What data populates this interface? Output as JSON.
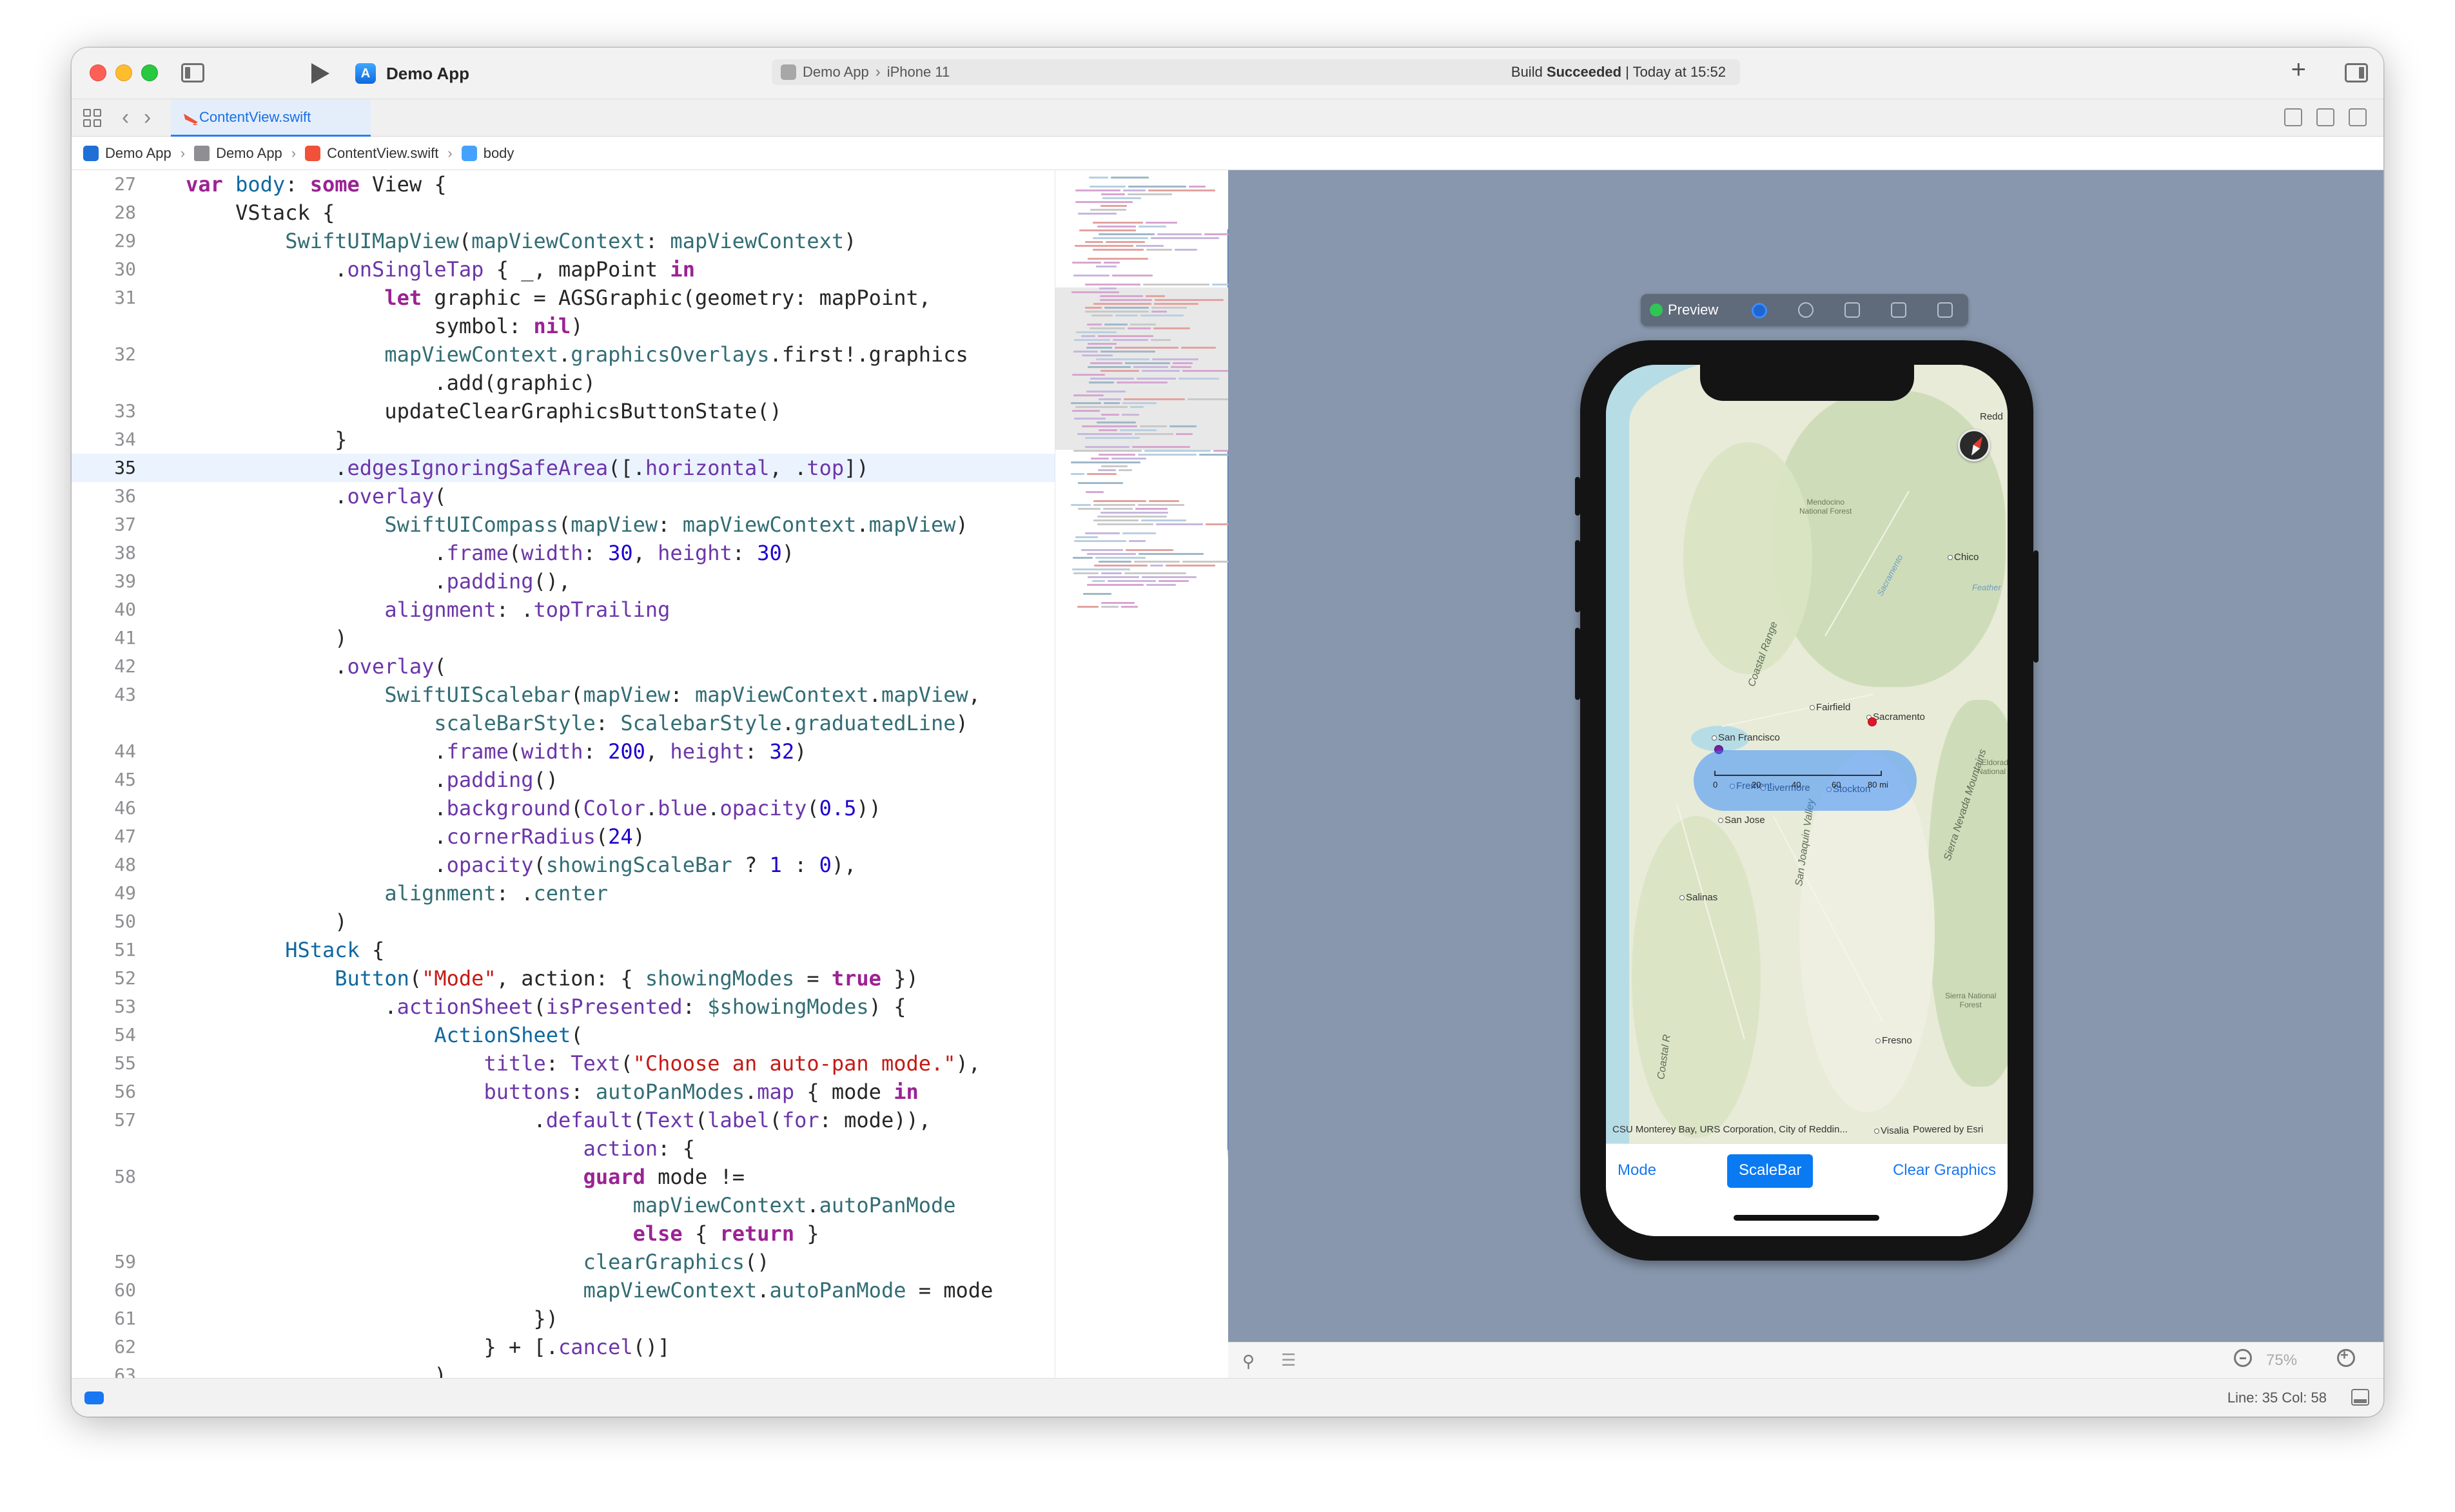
{
  "toolbar": {
    "app_title": "Demo App",
    "scheme_app": "Demo App",
    "scheme_device": "iPhone 11",
    "build_status_prefix": "Build",
    "build_status_bold": "Succeeded",
    "build_status_time": "| Today at 15:52"
  },
  "tabs": [
    {
      "label": "ContentView.swift",
      "active": true
    }
  ],
  "jumpbar": {
    "items": [
      "Demo App",
      "Demo App",
      "ContentView.swift",
      "body"
    ]
  },
  "editor": {
    "highlighted_line": 35,
    "lines": [
      {
        "num": "27",
        "tokens": [
          {
            "t": "    "
          },
          {
            "t": "var",
            "c": "kw"
          },
          {
            "t": " "
          },
          {
            "t": "body",
            "c": "ty"
          },
          {
            "t": ": "
          },
          {
            "t": "some",
            "c": "kw"
          },
          {
            "t": " View {"
          }
        ]
      },
      {
        "num": "28",
        "tokens": [
          {
            "t": "        VStack {"
          }
        ]
      },
      {
        "num": "29",
        "tokens": [
          {
            "t": "            "
          },
          {
            "t": "SwiftUIMapView",
            "c": "fn"
          },
          {
            "t": "("
          },
          {
            "t": "mapViewContext",
            "c": "fn"
          },
          {
            "t": ": "
          },
          {
            "t": "mapViewContext",
            "c": "fn"
          },
          {
            "t": ")"
          }
        ]
      },
      {
        "num": "30",
        "tokens": [
          {
            "t": "                ."
          },
          {
            "t": "onSingleTap",
            "c": "mt"
          },
          {
            "t": " { _, mapPoint "
          },
          {
            "t": "in",
            "c": "kw"
          }
        ]
      },
      {
        "num": "31",
        "tokens": [
          {
            "t": "                    "
          },
          {
            "t": "let",
            "c": "kw"
          },
          {
            "t": " graphic = AGSGraphic(geometry: mapPoint,"
          }
        ]
      },
      {
        "num": "",
        "tokens": [
          {
            "t": "                        symbol: "
          },
          {
            "t": "nil",
            "c": "kw"
          },
          {
            "t": ")"
          }
        ]
      },
      {
        "num": "32",
        "tokens": [
          {
            "t": "                    "
          },
          {
            "t": "mapViewContext",
            "c": "fn"
          },
          {
            "t": "."
          },
          {
            "t": "graphicsOverlays",
            "c": "fn"
          },
          {
            "t": ".first!.graphics"
          }
        ]
      },
      {
        "num": "",
        "tokens": [
          {
            "t": "                        .add(graphic)"
          }
        ]
      },
      {
        "num": "33",
        "tokens": [
          {
            "t": "                    updateClearGraphicsButtonState()"
          }
        ]
      },
      {
        "num": "34",
        "tokens": [
          {
            "t": "                }"
          }
        ]
      },
      {
        "num": "35",
        "tokens": [
          {
            "t": "                ."
          },
          {
            "t": "edgesIgnoringSafeArea",
            "c": "mt"
          },
          {
            "t": "([."
          },
          {
            "t": "horizontal",
            "c": "mt"
          },
          {
            "t": ", ."
          },
          {
            "t": "top",
            "c": "mt"
          },
          {
            "t": "])"
          }
        ]
      },
      {
        "num": "36",
        "tokens": [
          {
            "t": "                ."
          },
          {
            "t": "overlay",
            "c": "mt"
          },
          {
            "t": "("
          }
        ]
      },
      {
        "num": "37",
        "tokens": [
          {
            "t": "                    "
          },
          {
            "t": "SwiftUICompass",
            "c": "fn"
          },
          {
            "t": "("
          },
          {
            "t": "mapView",
            "c": "fn"
          },
          {
            "t": ": "
          },
          {
            "t": "mapViewContext",
            "c": "fn"
          },
          {
            "t": "."
          },
          {
            "t": "mapView",
            "c": "fn"
          },
          {
            "t": ")"
          }
        ]
      },
      {
        "num": "38",
        "tokens": [
          {
            "t": "                        ."
          },
          {
            "t": "frame",
            "c": "mt"
          },
          {
            "t": "("
          },
          {
            "t": "width",
            "c": "mt"
          },
          {
            "t": ": "
          },
          {
            "t": "30",
            "c": "nm"
          },
          {
            "t": ", "
          },
          {
            "t": "height",
            "c": "mt"
          },
          {
            "t": ": "
          },
          {
            "t": "30",
            "c": "nm"
          },
          {
            "t": ")"
          }
        ]
      },
      {
        "num": "39",
        "tokens": [
          {
            "t": "                        ."
          },
          {
            "t": "padding",
            "c": "mt"
          },
          {
            "t": "(),"
          }
        ]
      },
      {
        "num": "40",
        "tokens": [
          {
            "t": "                    "
          },
          {
            "t": "alignment",
            "c": "mt"
          },
          {
            "t": ": ."
          },
          {
            "t": "topTrailing",
            "c": "mt"
          }
        ]
      },
      {
        "num": "41",
        "tokens": [
          {
            "t": "                )"
          }
        ]
      },
      {
        "num": "42",
        "tokens": [
          {
            "t": "                ."
          },
          {
            "t": "overlay",
            "c": "mt"
          },
          {
            "t": "("
          }
        ]
      },
      {
        "num": "43",
        "tokens": [
          {
            "t": "                    "
          },
          {
            "t": "SwiftUIScalebar",
            "c": "fn"
          },
          {
            "t": "("
          },
          {
            "t": "mapView",
            "c": "fn"
          },
          {
            "t": ": "
          },
          {
            "t": "mapViewContext",
            "c": "fn"
          },
          {
            "t": "."
          },
          {
            "t": "mapView",
            "c": "fn"
          },
          {
            "t": ","
          }
        ]
      },
      {
        "num": "",
        "tokens": [
          {
            "t": "                        "
          },
          {
            "t": "scaleBarStyle",
            "c": "fn"
          },
          {
            "t": ": "
          },
          {
            "t": "ScalebarStyle",
            "c": "fn"
          },
          {
            "t": "."
          },
          {
            "t": "graduatedLine",
            "c": "fn"
          },
          {
            "t": ")"
          }
        ]
      },
      {
        "num": "44",
        "tokens": [
          {
            "t": "                        ."
          },
          {
            "t": "frame",
            "c": "mt"
          },
          {
            "t": "("
          },
          {
            "t": "width",
            "c": "mt"
          },
          {
            "t": ": "
          },
          {
            "t": "200",
            "c": "nm"
          },
          {
            "t": ", "
          },
          {
            "t": "height",
            "c": "mt"
          },
          {
            "t": ": "
          },
          {
            "t": "32",
            "c": "nm"
          },
          {
            "t": ")"
          }
        ]
      },
      {
        "num": "45",
        "tokens": [
          {
            "t": "                        ."
          },
          {
            "t": "padding",
            "c": "mt"
          },
          {
            "t": "()"
          }
        ]
      },
      {
        "num": "46",
        "tokens": [
          {
            "t": "                        ."
          },
          {
            "t": "background",
            "c": "mt"
          },
          {
            "t": "("
          },
          {
            "t": "Color",
            "c": "mt"
          },
          {
            "t": "."
          },
          {
            "t": "blue",
            "c": "mt"
          },
          {
            "t": "."
          },
          {
            "t": "opacity",
            "c": "mt"
          },
          {
            "t": "("
          },
          {
            "t": "0.5",
            "c": "nm"
          },
          {
            "t": "))"
          }
        ]
      },
      {
        "num": "47",
        "tokens": [
          {
            "t": "                        ."
          },
          {
            "t": "cornerRadius",
            "c": "mt"
          },
          {
            "t": "("
          },
          {
            "t": "24",
            "c": "nm"
          },
          {
            "t": ")"
          }
        ]
      },
      {
        "num": "48",
        "tokens": [
          {
            "t": "                        ."
          },
          {
            "t": "opacity",
            "c": "mt"
          },
          {
            "t": "("
          },
          {
            "t": "showingScaleBar",
            "c": "fn"
          },
          {
            "t": " ? "
          },
          {
            "t": "1",
            "c": "nm"
          },
          {
            "t": " : "
          },
          {
            "t": "0",
            "c": "nm"
          },
          {
            "t": "),"
          }
        ]
      },
      {
        "num": "49",
        "tokens": [
          {
            "t": "                    "
          },
          {
            "t": "alignment",
            "c": "fn"
          },
          {
            "t": ": ."
          },
          {
            "t": "center",
            "c": "fn"
          }
        ]
      },
      {
        "num": "50",
        "tokens": [
          {
            "t": "                )"
          }
        ]
      },
      {
        "num": "51",
        "tokens": [
          {
            "t": "            "
          },
          {
            "t": "HStack",
            "c": "ty"
          },
          {
            "t": " {"
          }
        ]
      },
      {
        "num": "52",
        "tokens": [
          {
            "t": "                "
          },
          {
            "t": "Button",
            "c": "ty"
          },
          {
            "t": "("
          },
          {
            "t": "\"Mode\"",
            "c": "st"
          },
          {
            "t": ", action: { "
          },
          {
            "t": "showingModes",
            "c": "fn"
          },
          {
            "t": " = "
          },
          {
            "t": "true",
            "c": "kw"
          },
          {
            "t": " })"
          }
        ]
      },
      {
        "num": "53",
        "tokens": [
          {
            "t": "                    ."
          },
          {
            "t": "actionSheet",
            "c": "mt"
          },
          {
            "t": "("
          },
          {
            "t": "isPresented",
            "c": "mt"
          },
          {
            "t": ": "
          },
          {
            "t": "$showingModes",
            "c": "fn"
          },
          {
            "t": ") {"
          }
        ]
      },
      {
        "num": "54",
        "tokens": [
          {
            "t": "                        "
          },
          {
            "t": "ActionSheet",
            "c": "ty"
          },
          {
            "t": "("
          }
        ]
      },
      {
        "num": "55",
        "tokens": [
          {
            "t": "                            "
          },
          {
            "t": "title",
            "c": "mt"
          },
          {
            "t": ": "
          },
          {
            "t": "Text",
            "c": "mt"
          },
          {
            "t": "("
          },
          {
            "t": "\"Choose an auto-pan mode.\"",
            "c": "st"
          },
          {
            "t": "),"
          }
        ]
      },
      {
        "num": "56",
        "tokens": [
          {
            "t": "                            "
          },
          {
            "t": "buttons",
            "c": "mt"
          },
          {
            "t": ": "
          },
          {
            "t": "autoPanModes",
            "c": "fn"
          },
          {
            "t": "."
          },
          {
            "t": "map",
            "c": "mt"
          },
          {
            "t": " { mode "
          },
          {
            "t": "in",
            "c": "kw"
          }
        ]
      },
      {
        "num": "57",
        "tokens": [
          {
            "t": "                                ."
          },
          {
            "t": "default",
            "c": "mt"
          },
          {
            "t": "("
          },
          {
            "t": "Text",
            "c": "mt"
          },
          {
            "t": "("
          },
          {
            "t": "label",
            "c": "mt"
          },
          {
            "t": "("
          },
          {
            "t": "for",
            "c": "mt"
          },
          {
            "t": ": mode)),"
          }
        ]
      },
      {
        "num": "",
        "tokens": [
          {
            "t": "                                    "
          },
          {
            "t": "action",
            "c": "mt"
          },
          {
            "t": ": {"
          }
        ]
      },
      {
        "num": "58",
        "tokens": [
          {
            "t": "                                    "
          },
          {
            "t": "guard",
            "c": "kw"
          },
          {
            "t": " mode !="
          }
        ]
      },
      {
        "num": "",
        "tokens": [
          {
            "t": "                                        "
          },
          {
            "t": "mapViewContext",
            "c": "fn"
          },
          {
            "t": "."
          },
          {
            "t": "autoPanMode",
            "c": "fn"
          }
        ]
      },
      {
        "num": "",
        "tokens": [
          {
            "t": "                                        "
          },
          {
            "t": "else",
            "c": "kw"
          },
          {
            "t": " { "
          },
          {
            "t": "return",
            "c": "kw"
          },
          {
            "t": " }"
          }
        ]
      },
      {
        "num": "59",
        "tokens": [
          {
            "t": "                                    "
          },
          {
            "t": "clearGraphics",
            "c": "fn"
          },
          {
            "t": "()"
          }
        ]
      },
      {
        "num": "60",
        "tokens": [
          {
            "t": "                                    "
          },
          {
            "t": "mapViewContext",
            "c": "fn"
          },
          {
            "t": "."
          },
          {
            "t": "autoPanMode",
            "c": "fn"
          },
          {
            "t": " = mode"
          }
        ]
      },
      {
        "num": "61",
        "tokens": [
          {
            "t": "                                })"
          }
        ]
      },
      {
        "num": "62",
        "tokens": [
          {
            "t": "                            } + [."
          },
          {
            "t": "cancel",
            "c": "mt"
          },
          {
            "t": "()]"
          }
        ]
      },
      {
        "num": "63",
        "tokens": [
          {
            "t": "                        )"
          }
        ]
      }
    ]
  },
  "preview": {
    "label": "Preview",
    "map": {
      "cities": [
        "Redd",
        "Chico",
        "Fairfield",
        "Sacramento",
        "San Francisco",
        "Fremont",
        "Livermore",
        "Stockton",
        "San Jose",
        "Salinas",
        "Fresno",
        "Visalia"
      ],
      "regions": [
        "Mendocino\nNational Forest",
        "Eldorad\nNational F",
        "Sierra National\nForest"
      ],
      "ranges": [
        "Coastal Range",
        "San Joaquin Valley",
        "Sierra Nevada Mountains",
        "Coastal R"
      ],
      "rivers": [
        "Sacramento",
        "Feather"
      ],
      "scalebar_ticks": [
        "0",
        "20",
        "40",
        "60",
        "80 mi"
      ],
      "attribution": "CSU Monterey Bay, URS Corporation, City of Reddin...",
      "powered_by": "Powered by Esri"
    },
    "buttons": {
      "mode": "Mode",
      "scalebar": "ScaleBar",
      "clear": "Clear Graphics"
    },
    "zoom": "75%"
  },
  "status": {
    "line_col": "Line: 35  Col: 58"
  },
  "colors": {
    "accent": "#1877f2",
    "canvas": "#8897ad",
    "highlight_line": "#ebf3fe",
    "red_pin": "#e2162b",
    "purple_pin": "#7b1fa2"
  }
}
